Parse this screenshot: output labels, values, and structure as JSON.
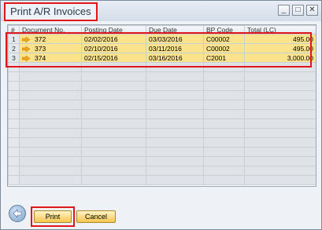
{
  "window": {
    "title": "Print A/R Invoices"
  },
  "window_buttons": {
    "minimize": "_",
    "maximize": "□",
    "close": "✕"
  },
  "grid": {
    "columns": [
      "#",
      "Document No.",
      "Posting Date",
      "Due Date",
      "BP Code",
      "Total (LC)"
    ],
    "rows": [
      {
        "num": "1",
        "doc": "372",
        "posting": "02/02/2016",
        "due": "03/03/2016",
        "bp": "C00002",
        "total": "495.00"
      },
      {
        "num": "2",
        "doc": "373",
        "posting": "02/10/2016",
        "due": "03/11/2016",
        "bp": "C00002",
        "total": "495.00"
      },
      {
        "num": "3",
        "doc": "374",
        "posting": "02/15/2016",
        "due": "03/16/2016",
        "bp": "C2001",
        "total": "3,000.00"
      }
    ],
    "empty_row_count": 13
  },
  "footer": {
    "print_label": "Print",
    "cancel_label": "Cancel"
  },
  "colors": {
    "row_highlight": "#fbe28c",
    "annotation_red": "#e0161b",
    "button_gold": "#f4c64f"
  }
}
